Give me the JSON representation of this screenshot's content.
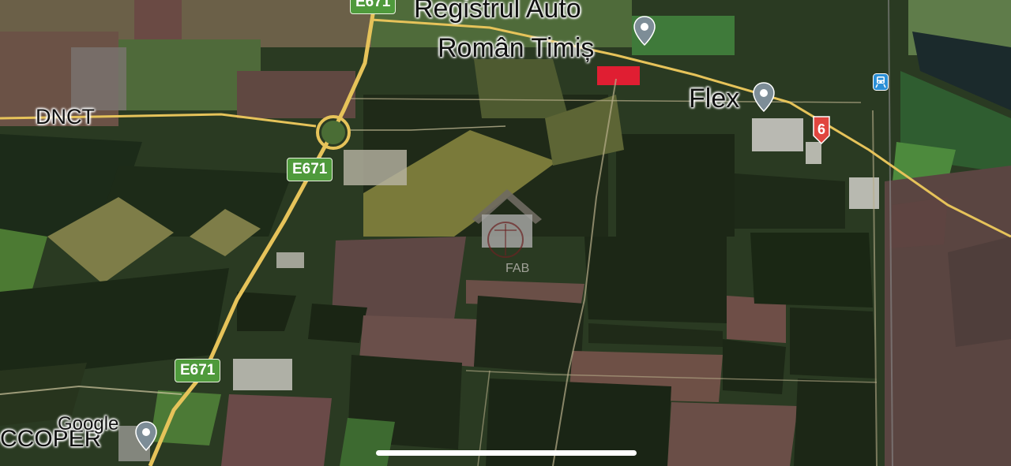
{
  "map": {
    "type": "satellite-3d",
    "attribution": "Google",
    "places": [
      {
        "id": "registrul-auto-line1",
        "text": "Registrul Auto"
      },
      {
        "id": "registrul-auto-line2",
        "text": "Român Timiș"
      },
      {
        "id": "flex",
        "text": "Flex"
      },
      {
        "id": "dnct",
        "text": "DNCT"
      },
      {
        "id": "ccoper",
        "text": "CCOPER"
      }
    ],
    "roads": [
      {
        "id": "e671-top",
        "label": "E671"
      },
      {
        "id": "e671-mid",
        "label": "E671"
      },
      {
        "id": "e671-bottom",
        "label": "E671"
      }
    ],
    "route_badge": {
      "label": "6",
      "color": "#e0463f"
    },
    "icons": [
      "location-pin-icon",
      "train-station-icon",
      "house-watermark-icon"
    ],
    "watermark": {
      "text": "FAB"
    }
  },
  "colors": {
    "road": "#e6c35a",
    "highway_shield": "#4f9a3c",
    "pin": "#7d8d97",
    "home_bar": "#ffffff"
  }
}
